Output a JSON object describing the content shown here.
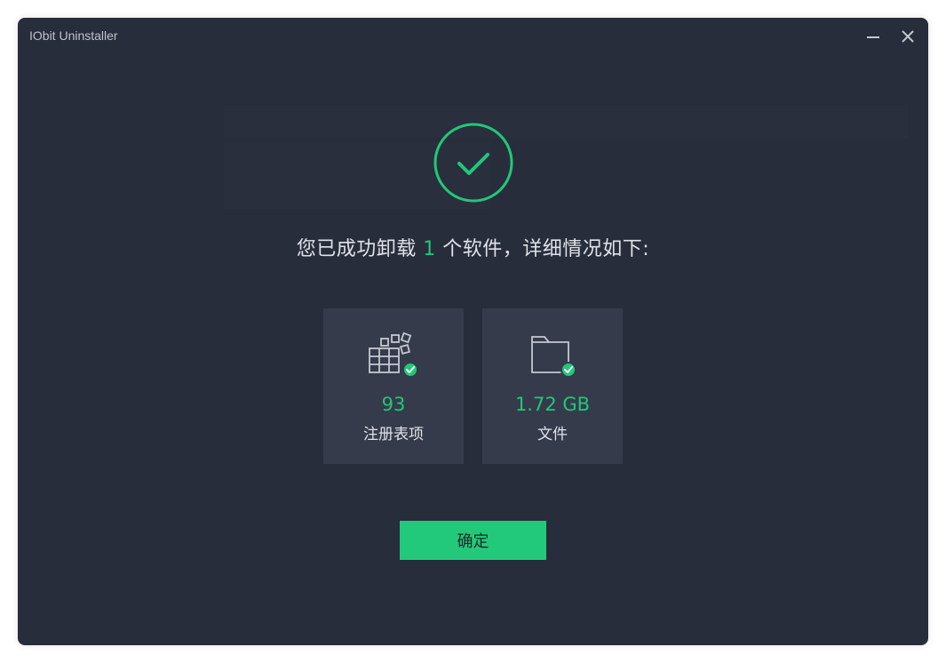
{
  "window": {
    "title": "IObit Uninstaller",
    "minimize_icon": "minimize-icon",
    "close_icon": "close-icon"
  },
  "result": {
    "icon": "success-check-icon",
    "text_before": "您已成功卸载 ",
    "count": "1",
    "text_after": " 个软件，详细情况如下:"
  },
  "cards": [
    {
      "icon": "registry-icon",
      "value": "93",
      "label": "注册表项"
    },
    {
      "icon": "folder-icon",
      "value": "1.72 GB",
      "label": "文件"
    }
  ],
  "confirm_label": "确定",
  "colors": {
    "background": "#282d3c",
    "card": "#353b4b",
    "accent": "#20c878",
    "text": "#dfe2e8"
  }
}
